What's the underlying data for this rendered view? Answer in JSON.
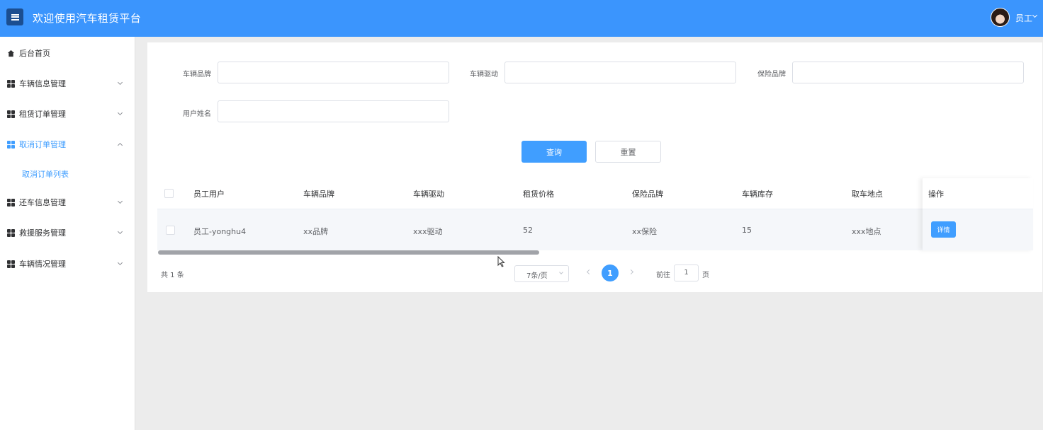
{
  "header": {
    "title": "欢迎使用汽车租赁平台",
    "user": "员工"
  },
  "sidebar": {
    "items": [
      {
        "label": "后台首页",
        "icon": "home-icon"
      },
      {
        "label": "车辆信息管理",
        "icon": "grid-icon"
      },
      {
        "label": "租赁订单管理",
        "icon": "grid-icon"
      },
      {
        "label": "取消订单管理",
        "icon": "grid-icon",
        "expanded": true
      },
      {
        "label": "还车信息管理",
        "icon": "grid-icon"
      },
      {
        "label": "救援服务管理",
        "icon": "grid-icon"
      },
      {
        "label": "车辆情况管理",
        "icon": "grid-icon"
      }
    ],
    "sub_item": "取消订单列表"
  },
  "search": {
    "brand_label": "车辆品牌",
    "drive_label": "车辆驱动",
    "insurance_label": "保险品牌",
    "username_label": "用户姓名",
    "query_btn": "查询",
    "reset_btn": "重置"
  },
  "table": {
    "headers": [
      "员工用户",
      "车辆品牌",
      "车辆驱动",
      "租赁价格",
      "保险品牌",
      "车辆库存",
      "取车地点",
      "操作"
    ],
    "rows": [
      [
        "员工-yonghu4",
        "xx品牌",
        "xxx驱动",
        "52",
        "xx保险",
        "15",
        "xxx地点",
        "详情"
      ]
    ]
  },
  "pagination": {
    "total": "共 1 条",
    "page_size": "7条/页",
    "current_page": "1",
    "goto_label": "前往",
    "goto_value": "1",
    "goto_unit": "页"
  },
  "colors": {
    "header_bg": "#3b95fd",
    "primary": "#409eff",
    "menu_btn": "#1b4e91"
  }
}
